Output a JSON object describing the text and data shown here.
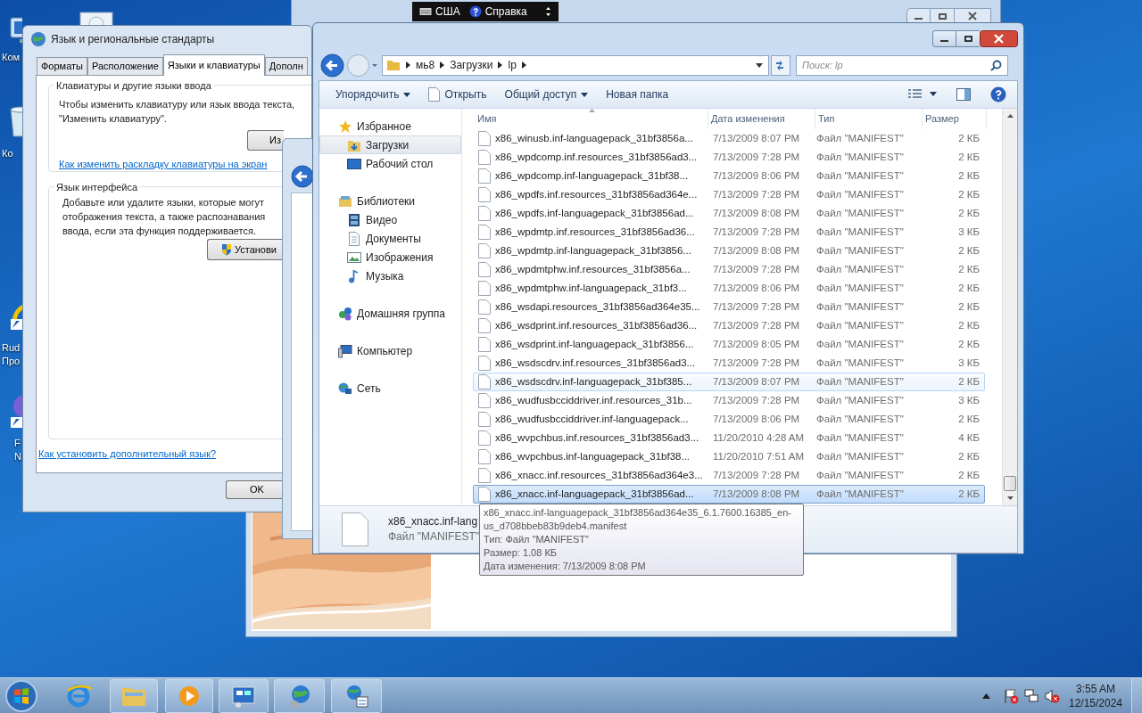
{
  "desktop": {
    "icons": [
      {
        "lines": [
          "Ком"
        ]
      },
      {
        "lines": [
          "Ко"
        ]
      },
      {
        "lines": [
          "Rud",
          "Про"
        ]
      },
      {
        "lines": [
          "F",
          "N"
        ]
      }
    ]
  },
  "language_bar": {
    "layout": "США",
    "help": "Справка"
  },
  "region_dialog": {
    "title": "Язык и региональные стандарты",
    "tabs": [
      {
        "label": "Форматы",
        "selected": false
      },
      {
        "label": "Расположение",
        "selected": false
      },
      {
        "label": "Языки и клавиатуры",
        "selected": true
      },
      {
        "label": "Дополн",
        "selected": false
      }
    ],
    "keyboards_group": {
      "title": "Клавиатуры и другие языки ввода",
      "lines": [
        "Чтобы изменить клавиатуру или язык ввода текста,",
        "\"Изменить клавиатуру\"."
      ],
      "button": "Из",
      "link": "Как изменить раскладку клавиатуры на экран"
    },
    "interface_group": {
      "title": "Язык интерфейса",
      "lines": [
        "Добавьте или удалите языки, которые могут",
        "отображения текста, а также распознавания",
        "ввода, если эта функция поддерживается."
      ],
      "button": "Установи"
    },
    "link": "Как установить дополнительный язык?",
    "ok_button": "OK"
  },
  "explorer": {
    "breadcrumb": [
      "мь8",
      "Загрузки",
      "lp"
    ],
    "search_placeholder": "Поиск: lp",
    "toolbar": [
      {
        "label": "Упорядочить",
        "dropdown": true
      },
      {
        "label": "Открыть",
        "dropdown": false
      },
      {
        "label": "Общий доступ",
        "dropdown": true
      },
      {
        "label": "Новая папка",
        "dropdown": false
      }
    ],
    "nav": [
      {
        "label": "Избранное",
        "selected": false,
        "children": [
          {
            "label": "Загрузки",
            "selected": true
          },
          {
            "label": "Рабочий стол",
            "selected": false
          }
        ]
      },
      {
        "label": "Библиотеки",
        "selected": false,
        "children": [
          {
            "label": "Видео",
            "selected": false
          },
          {
            "label": "Документы",
            "selected": false
          },
          {
            "label": "Изображения",
            "selected": false
          },
          {
            "label": "Музыка",
            "selected": false
          }
        ]
      },
      {
        "label": "Домашняя группа",
        "selected": false
      },
      {
        "label": "Компьютер",
        "selected": false
      },
      {
        "label": "Сеть",
        "selected": false
      }
    ],
    "columns": [
      "Имя",
      "Дата изменения",
      "Тип",
      "Размер"
    ],
    "rows": [
      {
        "name": "x86_winusb.inf-languagepack_31bf3856a...",
        "date": "7/13/2009 8:07 PM",
        "type": "Файл \"MANIFEST\"",
        "size": "2 КБ",
        "selected": false,
        "hovered": false
      },
      {
        "name": "x86_wpdcomp.inf.resources_31bf3856ad3...",
        "date": "7/13/2009 7:28 PM",
        "type": "Файл \"MANIFEST\"",
        "size": "2 КБ",
        "selected": false,
        "hovered": false
      },
      {
        "name": "x86_wpdcomp.inf-languagepack_31bf38...",
        "date": "7/13/2009 8:06 PM",
        "type": "Файл \"MANIFEST\"",
        "size": "2 КБ",
        "selected": false,
        "hovered": false
      },
      {
        "name": "x86_wpdfs.inf.resources_31bf3856ad364e...",
        "date": "7/13/2009 7:28 PM",
        "type": "Файл \"MANIFEST\"",
        "size": "2 КБ",
        "selected": false,
        "hovered": false
      },
      {
        "name": "x86_wpdfs.inf-languagepack_31bf3856ad...",
        "date": "7/13/2009 8:08 PM",
        "type": "Файл \"MANIFEST\"",
        "size": "2 КБ",
        "selected": false,
        "hovered": false
      },
      {
        "name": "x86_wpdmtp.inf.resources_31bf3856ad36...",
        "date": "7/13/2009 7:28 PM",
        "type": "Файл \"MANIFEST\"",
        "size": "3 КБ",
        "selected": false,
        "hovered": false
      },
      {
        "name": "x86_wpdmtp.inf-languagepack_31bf3856...",
        "date": "7/13/2009 8:08 PM",
        "type": "Файл \"MANIFEST\"",
        "size": "2 КБ",
        "selected": false,
        "hovered": false
      },
      {
        "name": "x86_wpdmtphw.inf.resources_31bf3856a...",
        "date": "7/13/2009 7:28 PM",
        "type": "Файл \"MANIFEST\"",
        "size": "2 КБ",
        "selected": false,
        "hovered": false
      },
      {
        "name": "x86_wpdmtphw.inf-languagepack_31bf3...",
        "date": "7/13/2009 8:06 PM",
        "type": "Файл \"MANIFEST\"",
        "size": "2 КБ",
        "selected": false,
        "hovered": false
      },
      {
        "name": "x86_wsdapi.resources_31bf3856ad364e35...",
        "date": "7/13/2009 7:28 PM",
        "type": "Файл \"MANIFEST\"",
        "size": "2 КБ",
        "selected": false,
        "hovered": false
      },
      {
        "name": "x86_wsdprint.inf.resources_31bf3856ad36...",
        "date": "7/13/2009 7:28 PM",
        "type": "Файл \"MANIFEST\"",
        "size": "2 КБ",
        "selected": false,
        "hovered": false
      },
      {
        "name": "x86_wsdprint.inf-languagepack_31bf3856...",
        "date": "7/13/2009 8:05 PM",
        "type": "Файл \"MANIFEST\"",
        "size": "2 КБ",
        "selected": false,
        "hovered": false
      },
      {
        "name": "x86_wsdscdrv.inf.resources_31bf3856ad3...",
        "date": "7/13/2009 7:28 PM",
        "type": "Файл \"MANIFEST\"",
        "size": "3 КБ",
        "selected": false,
        "hovered": false
      },
      {
        "name": "x86_wsdscdrv.inf-languagepack_31bf385...",
        "date": "7/13/2009 8:07 PM",
        "type": "Файл \"MANIFEST\"",
        "size": "2 КБ",
        "selected": false,
        "hovered": true
      },
      {
        "name": "x86_wudfusbcciddriver.inf.resources_31b...",
        "date": "7/13/2009 7:28 PM",
        "type": "Файл \"MANIFEST\"",
        "size": "3 КБ",
        "selected": false,
        "hovered": false
      },
      {
        "name": "x86_wudfusbcciddriver.inf-languagepack...",
        "date": "7/13/2009 8:06 PM",
        "type": "Файл \"MANIFEST\"",
        "size": "2 КБ",
        "selected": false,
        "hovered": false
      },
      {
        "name": "x86_wvpchbus.inf.resources_31bf3856ad3...",
        "date": "11/20/2010 4:28 AM",
        "type": "Файл \"MANIFEST\"",
        "size": "4 КБ",
        "selected": false,
        "hovered": false
      },
      {
        "name": "x86_wvpchbus.inf-languagepack_31bf38...",
        "date": "11/20/2010 7:51 AM",
        "type": "Файл \"MANIFEST\"",
        "size": "2 КБ",
        "selected": false,
        "hovered": false
      },
      {
        "name": "x86_xnacc.inf.resources_31bf3856ad364e3...",
        "date": "7/13/2009 7:28 PM",
        "type": "Файл \"MANIFEST\"",
        "size": "2 КБ",
        "selected": false,
        "hovered": false
      },
      {
        "name": "x86_xnacc.inf-languagepack_31bf3856ad...",
        "date": "7/13/2009 8:08 PM",
        "type": "Файл \"MANIFEST\"",
        "size": "2 КБ",
        "selected": true,
        "hovered": false
      }
    ],
    "details": {
      "name": "x86_xnacc.inf-lang",
      "type": "Файл \"MANIFEST\""
    },
    "tooltip": {
      "name": "x86_xnacc.inf-languagepack_31bf3856ad364e35_6.1.7600.16385_en-us_d708bbeb83b9deb4.manifest",
      "lines": [
        "Тип: Файл \"MANIFEST\"",
        "Размер: 1.08 КБ",
        "Дата изменения: 7/13/2009 8:08 PM"
      ]
    }
  },
  "taskbar": {
    "time": "3:55 AM",
    "date": "12/15/2024"
  }
}
